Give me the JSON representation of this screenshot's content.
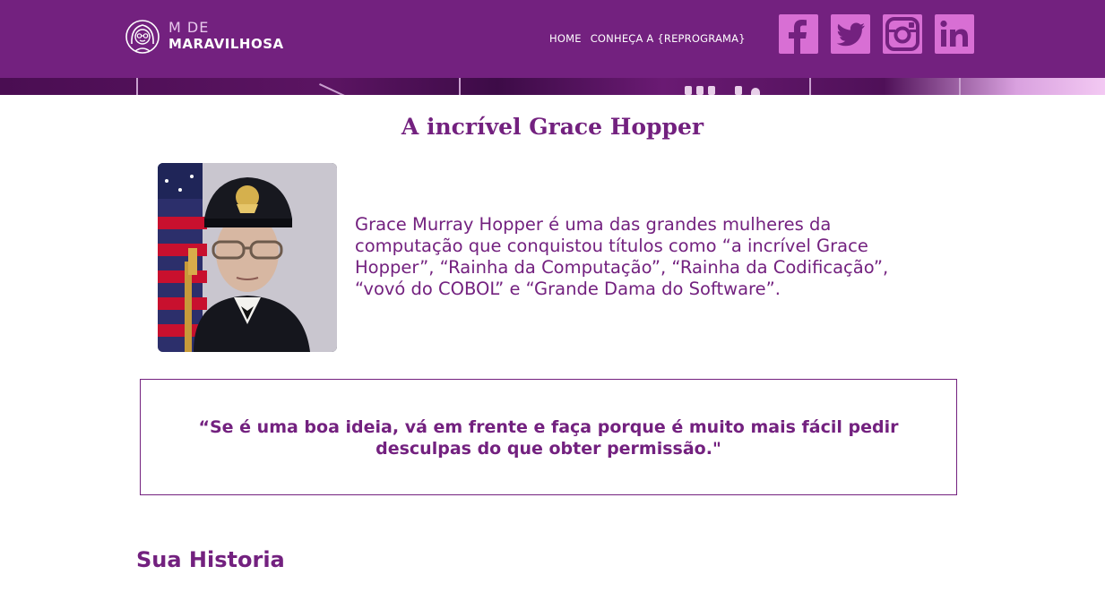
{
  "brand": {
    "top": "M DE",
    "bottom": "MARAVILHOSA"
  },
  "nav": {
    "items": [
      {
        "label": "HOME"
      },
      {
        "label": "CONHEÇA A {REPROGRAMA}"
      }
    ]
  },
  "socials": [
    {
      "icon": "facebook-icon"
    },
    {
      "icon": "twitter-icon"
    },
    {
      "icon": "instagram-icon"
    },
    {
      "icon": "linkedin-icon"
    }
  ],
  "colors": {
    "header": "#73217f",
    "accent": "#d86fd4",
    "text": "#73217f"
  },
  "main": {
    "title": "A incrível Grace Hopper",
    "intro": "Grace Murray Hopper é uma das grandes mulheres da computação que conquistou títulos como “a incrível Grace Hopper”, “Rainha da Computação”, “Rainha da Codificação”, “vovó do COBOL” e “Grande Dama do Software”.",
    "quote": "“Se é uma boa ideia, vá em frente e faça porque é muito mais fácil pedir desculpas do que obter permissão.\"",
    "section_title": "Sua Historia"
  }
}
